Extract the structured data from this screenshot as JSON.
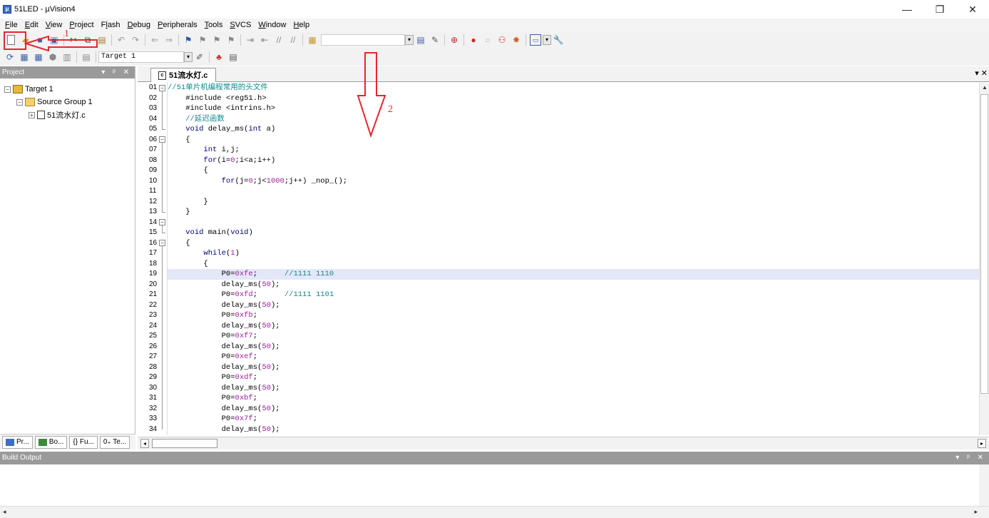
{
  "window": {
    "title": "51LED  - µVision4"
  },
  "menu": [
    {
      "label": "File",
      "u": "F",
      "rest": "ile"
    },
    {
      "label": "Edit",
      "u": "E",
      "rest": "dit"
    },
    {
      "label": "View",
      "u": "V",
      "rest": "iew"
    },
    {
      "label": "Project",
      "u": "P",
      "rest": "roject"
    },
    {
      "label": "Flash",
      "u": "F",
      "rest": "lash",
      "full_pre": "F",
      "underline_mid": "l",
      "post": "ash"
    },
    {
      "label": "Debug",
      "u": "D",
      "rest": "ebug"
    },
    {
      "label": "Peripherals",
      "u": "P",
      "rest": "eripherals"
    },
    {
      "label": "Tools",
      "u": "T",
      "rest": "ools"
    },
    {
      "label": "SVCS",
      "u": "S",
      "rest": "VCS"
    },
    {
      "label": "Window",
      "u": "W",
      "rest": "indow"
    },
    {
      "label": "Help",
      "u": "H",
      "rest": "elp"
    }
  ],
  "toolbar2": {
    "target_combo": "Target 1"
  },
  "project_panel": {
    "title": "Project",
    "tree": [
      {
        "label": "Target 1",
        "level": 0,
        "toggle": "−"
      },
      {
        "label": "Source Group 1",
        "level": 1,
        "toggle": "−"
      },
      {
        "label": "51流水灯.c",
        "level": 2,
        "toggle": "+"
      }
    ],
    "tabs": [
      "Pr...",
      "Bo...",
      "{} Fu...",
      "0₊ Te..."
    ]
  },
  "editor": {
    "tab_label": "51流水灯.c",
    "highlighted_line": 19,
    "lines": [
      {
        "n": "01",
        "text": "//51单片机编程常用的头文件",
        "type": "comment"
      },
      {
        "n": "02",
        "text": "    #include <reg51.h>",
        "type": "plain"
      },
      {
        "n": "03",
        "text": "    #include <intrins.h>",
        "type": "plain"
      },
      {
        "n": "04",
        "text": "    //延迟函数",
        "type": "comment"
      },
      {
        "n": "05",
        "text": "    void delay_ms(int a)",
        "type": "plain"
      },
      {
        "n": "06",
        "text": "    {",
        "type": "plain"
      },
      {
        "n": "07",
        "text": "        int i,j;",
        "type": "plain"
      },
      {
        "n": "08",
        "text": "        for(i=0;i<a;i++)",
        "type": "plain"
      },
      {
        "n": "09",
        "text": "        {",
        "type": "plain"
      },
      {
        "n": "10",
        "text": "            for(j=0;j<1000;j++) _nop_();",
        "type": "plain"
      },
      {
        "n": "11",
        "text": "",
        "type": "plain"
      },
      {
        "n": "12",
        "text": "        }",
        "type": "plain"
      },
      {
        "n": "13",
        "text": "    }",
        "type": "plain"
      },
      {
        "n": "14",
        "text": "",
        "type": "plain"
      },
      {
        "n": "15",
        "text": "    void main(void)",
        "type": "plain"
      },
      {
        "n": "16",
        "text": "    {",
        "type": "plain"
      },
      {
        "n": "17",
        "text": "        while(1)",
        "type": "plain"
      },
      {
        "n": "18",
        "text": "        {",
        "type": "plain"
      },
      {
        "n": "19",
        "text": "            P0=0xfe;      //1111 1110",
        "type": "plain"
      },
      {
        "n": "20",
        "text": "            delay_ms(50);",
        "type": "plain"
      },
      {
        "n": "21",
        "text": "            P0=0xfd;      //1111 1101",
        "type": "plain"
      },
      {
        "n": "22",
        "text": "            delay_ms(50);",
        "type": "plain"
      },
      {
        "n": "23",
        "text": "            P0=0xfb;",
        "type": "plain"
      },
      {
        "n": "24",
        "text": "            delay_ms(50);",
        "type": "plain"
      },
      {
        "n": "25",
        "text": "            P0=0xf7;",
        "type": "plain"
      },
      {
        "n": "26",
        "text": "            delay_ms(50);",
        "type": "plain"
      },
      {
        "n": "27",
        "text": "            P0=0xef;",
        "type": "plain"
      },
      {
        "n": "28",
        "text": "            delay_ms(50);",
        "type": "plain"
      },
      {
        "n": "29",
        "text": "            P0=0xdf;",
        "type": "plain"
      },
      {
        "n": "30",
        "text": "            delay_ms(50);",
        "type": "plain"
      },
      {
        "n": "31",
        "text": "            P0=0xbf;",
        "type": "plain"
      },
      {
        "n": "32",
        "text": "            delay_ms(50);",
        "type": "plain"
      },
      {
        "n": "33",
        "text": "            P0=0x7f;",
        "type": "plain"
      },
      {
        "n": "34",
        "text": "            delay_ms(50);",
        "type": "plain"
      }
    ]
  },
  "build_output": {
    "title": "Build Output"
  },
  "annotations": {
    "label1": "1",
    "label2": "2"
  },
  "colors": {
    "annotation_red": "#e8262f",
    "panel_header": "#9a9a9a",
    "line_highlight": "#e4e7f8",
    "comment": "#0f8b8d",
    "number": "#a020a0"
  }
}
